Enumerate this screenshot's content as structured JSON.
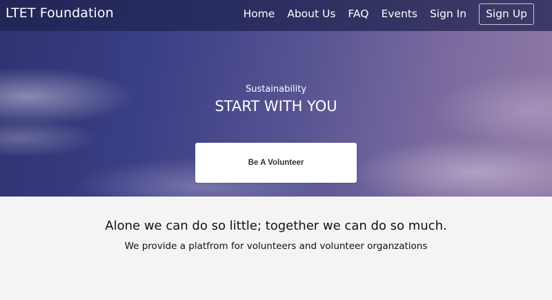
{
  "nav": {
    "brand": "LTET Foundation",
    "links": [
      {
        "label": "Home"
      },
      {
        "label": "About Us"
      },
      {
        "label": "FAQ"
      },
      {
        "label": "Events"
      },
      {
        "label": "Sign In"
      }
    ],
    "signup_label": "Sign Up"
  },
  "hero": {
    "subtitle": "Sustainability",
    "title": "START WITH YOU",
    "cta_label": "Be A Volunteer"
  },
  "about": {
    "tagline": "Alone we can do so little; together we can do so much.",
    "mission": "We provide a platfrom for volunteers and volunteer organzations"
  },
  "colors": {
    "nav_background": "#1e224e",
    "hero_sky_dark": "#2f3370",
    "hero_sky_light": "#8e7aa6",
    "page_background": "#f4f4f4",
    "text_light": "#ffffff",
    "text_dark": "#111111"
  }
}
